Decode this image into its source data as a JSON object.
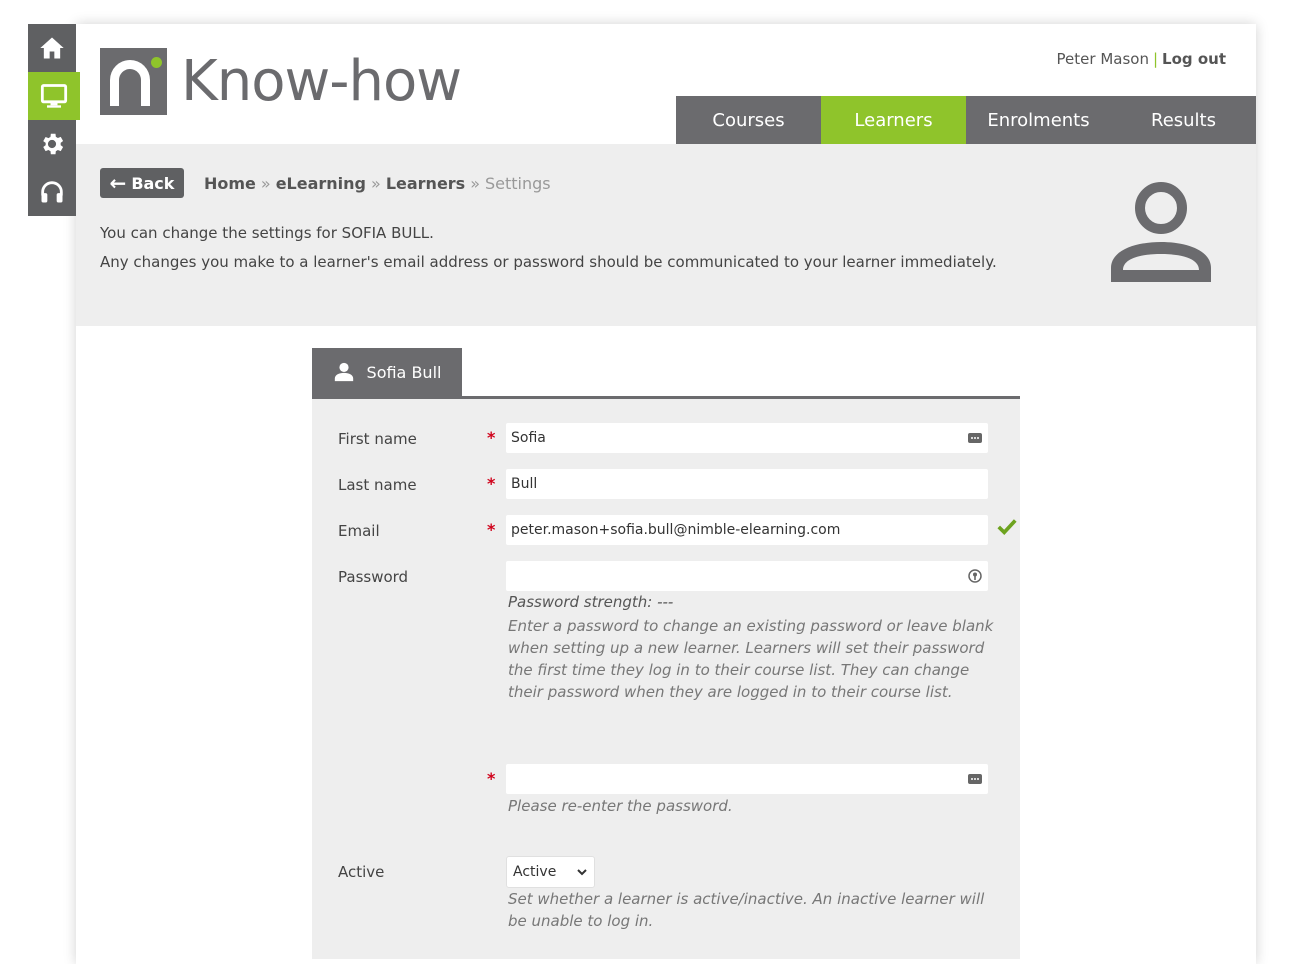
{
  "app": {
    "brand": "Know-how"
  },
  "rail": {
    "items": [
      {
        "icon": "home-icon"
      },
      {
        "icon": "monitor-icon",
        "active": true
      },
      {
        "icon": "gear-icon"
      },
      {
        "icon": "headset-icon"
      }
    ]
  },
  "user": {
    "name": "Peter Mason",
    "separator": "|",
    "logout_label": "Log out"
  },
  "nav": {
    "tabs": [
      {
        "label": "Courses"
      },
      {
        "label": "Learners",
        "active": true
      },
      {
        "label": "Enrolments"
      },
      {
        "label": "Results"
      }
    ]
  },
  "band": {
    "back_label": "Back",
    "breadcrumb": {
      "home": "Home",
      "elearning": "eLearning",
      "learners": "Learners",
      "current": "Settings",
      "separator": "»"
    },
    "line1": "You can change the settings for SOFIA BULL.",
    "line2": "Any changes you make to a learner's email address or password should be communicated to your learner immediately."
  },
  "form": {
    "tab_label": "Sofia Bull",
    "required_mark": "*",
    "first_name": {
      "label": "First name",
      "value": "Sofia"
    },
    "last_name": {
      "label": "Last name",
      "value": "Bull"
    },
    "email": {
      "label": "Email",
      "value": "peter.mason+sofia.bull@nimble-elearning.com",
      "valid": true
    },
    "password": {
      "label": "Password",
      "value": "",
      "strength": "Password strength: ---",
      "hint": "Enter a password to change an existing password or leave blank when setting up a new learner. Learners will set their password the first time they log in to their course list. They can change their password when they are logged in to their course list."
    },
    "confirm_password": {
      "value": "",
      "hint": "Please re-enter the password."
    },
    "active": {
      "label": "Active",
      "selected": "Active",
      "hint": "Set whether a learner is active/inactive. An inactive learner will be unable to log in."
    }
  },
  "colors": {
    "accent": "#8fc42b",
    "dark_grey": "#6b6b6e",
    "rail_grey": "#5f6062",
    "band_grey": "#eeeeee",
    "required": "#d0021b"
  }
}
